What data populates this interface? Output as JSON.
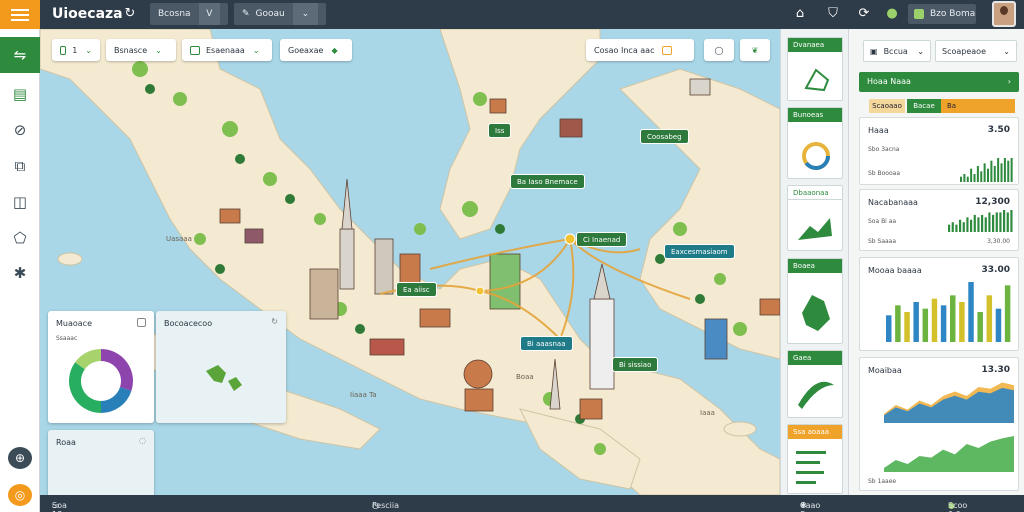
{
  "topbar": {
    "title": "Uioecaza",
    "dropdown_1": "Bcosna",
    "dropdown_1_chev": "V",
    "dropdown_2": "Gooau",
    "user_button": "Bzo Boma"
  },
  "map": {
    "filters": [
      {
        "label": "1"
      },
      {
        "label": "Bsnasce"
      },
      {
        "label": "Esaenaaa"
      },
      {
        "label": "Goeaxae"
      }
    ],
    "search_pill": "Cosao Inca aac",
    "labels": [
      {
        "text": "Iss"
      },
      {
        "text": "Coosabeg"
      },
      {
        "text": "Ba Iaso Bnemace"
      },
      {
        "text": "Ci Inaenad"
      },
      {
        "text": "Eaxcesmasiaom"
      },
      {
        "text": "Ea aiisc"
      },
      {
        "text": "Bi aaasnaa"
      },
      {
        "text": "Bi sissiao"
      }
    ],
    "land_text": [
      "Uasaaa",
      "Boaa",
      "Iiaaa Ta",
      "Iaaa"
    ]
  },
  "bottom_cards": {
    "donut_title": "Muaoace",
    "donut_sub": "Ssaaac",
    "map_card_title": "Bocoacecoo",
    "third_title": "Roaa"
  },
  "donut": {
    "segments": [
      {
        "value": 30,
        "color": "#8e44ad"
      },
      {
        "value": 20,
        "color": "#2980b9"
      },
      {
        "value": 35,
        "color": "#27ae60"
      },
      {
        "value": 15,
        "color": "#a6d36b"
      }
    ]
  },
  "statusbar": {
    "left": "Soa 18 3ba",
    "center": "Fesciia",
    "right_1": "Caao Soaaa",
    "right_2": "Scoo 0 0 Iaa"
  },
  "rc1": {
    "cards": [
      {
        "title": "Dvanaea"
      },
      {
        "title": "Bunoeas oaaa"
      },
      {
        "title": "Dbaaonaa"
      },
      {
        "title": "Boaea"
      },
      {
        "title": "Gaea"
      },
      {
        "title": "Ssa aoaaa"
      }
    ]
  },
  "rc2": {
    "dropdown_1": "Bccua",
    "dropdown_2": "Scoapeaoe",
    "green_header": "Hoaa Naaa",
    "tabs": [
      "Scaoaao",
      "Bacae",
      "Ba"
    ],
    "panels": [
      {
        "title": "Haaa",
        "value": "3.50",
        "sub1": "Sbo 3acna",
        "sub2": "Sb Boooaa"
      },
      {
        "title": "Nacabanaaa",
        "value": "12,300",
        "sub1": "Soa Bi aa",
        "sub2": "Sb Saaaa",
        "sub3": "3,30.00"
      },
      {
        "title": "Mooaa baaaa",
        "value": "33.00"
      },
      {
        "title": "Moaibaa",
        "value": "13.30",
        "sub1": "Sb 1aaee"
      }
    ]
  },
  "chart_data": [
    {
      "type": "bar",
      "values": [
        2,
        3,
        2,
        5,
        3,
        6,
        4,
        7,
        5,
        8,
        6,
        9,
        7,
        9,
        8,
        9
      ]
    },
    {
      "type": "bar",
      "values": [
        3,
        4,
        3,
        5,
        4,
        6,
        5,
        7,
        6,
        7,
        6,
        8,
        7,
        8,
        8,
        9,
        8,
        9
      ]
    },
    {
      "type": "bar",
      "values": [
        40,
        55,
        45,
        60,
        50,
        65,
        55,
        70,
        60,
        90,
        45,
        70,
        50,
        85
      ],
      "colors": [
        "#2f86c4",
        "#6cb33f",
        "#d4c02a"
      ]
    },
    {
      "type": "area",
      "values": [
        10,
        20,
        15,
        25,
        20,
        30,
        35,
        30,
        40,
        38,
        45,
        42
      ]
    },
    {
      "type": "area",
      "values": [
        5,
        15,
        10,
        20,
        18,
        28,
        22,
        35,
        30,
        38,
        42,
        45
      ]
    }
  ]
}
